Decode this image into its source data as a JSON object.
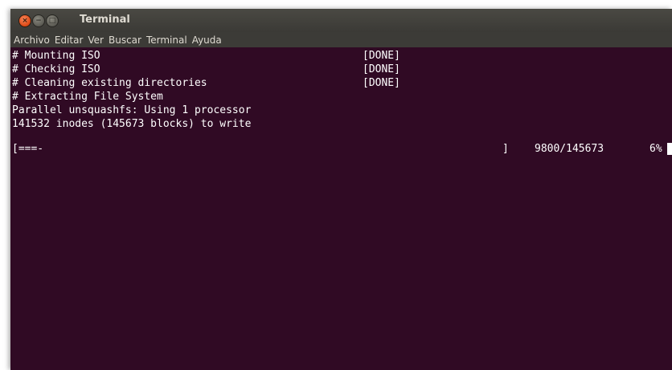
{
  "window": {
    "title": "Terminal",
    "buttons": {
      "close": "×",
      "minimize": "−",
      "maximize": "□"
    }
  },
  "menubar": {
    "items": [
      "Archivo",
      "Editar",
      "Ver",
      "Buscar",
      "Terminal",
      "Ayuda"
    ]
  },
  "terminal": {
    "lines": [
      {
        "text": "# Mounting ISO",
        "status": "[DONE]"
      },
      {
        "text": "# Checking ISO",
        "status": "[DONE]"
      },
      {
        "text": "# Cleaning existing directories",
        "status": "[DONE]"
      },
      {
        "text": "# Extracting File System",
        "status": ""
      },
      {
        "text": "Parallel unsquashfs: Using 1 processor",
        "status": ""
      },
      {
        "text": "141532 inodes (145673 blocks) to write",
        "status": ""
      }
    ],
    "progress": {
      "bar_open": "[===-",
      "bar_close": "]",
      "count": "9800/145673",
      "percent": "6%",
      "fraction": 0.06
    }
  },
  "colors": {
    "terminal_bg": "#300a24",
    "titlebar_bg": "#3c3b37",
    "close_button": "#dd4814",
    "text": "#ffffff"
  }
}
